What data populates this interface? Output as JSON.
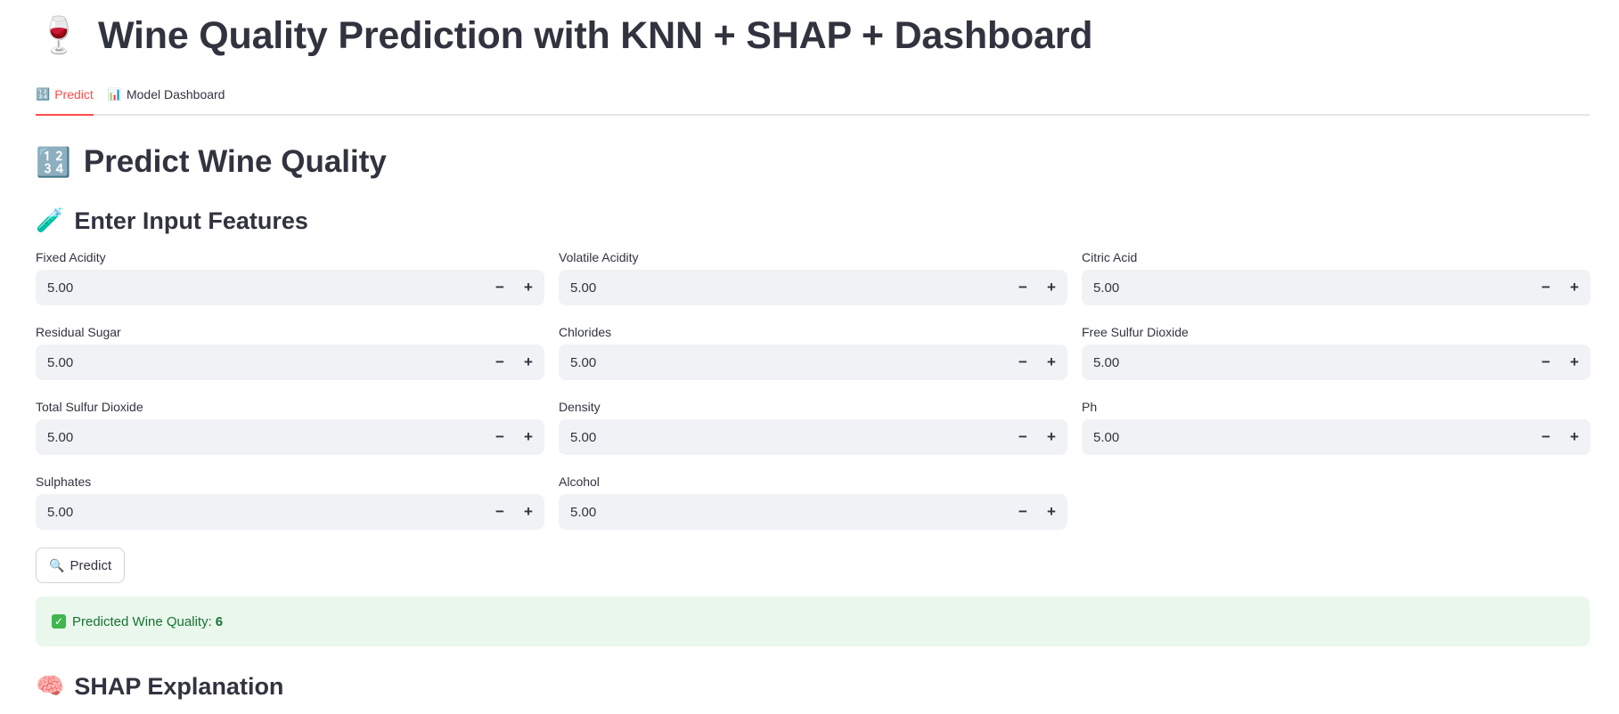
{
  "header": {
    "icon": "wine-glass-icon",
    "icon_glyph": "🍷",
    "title": "Wine Quality Prediction with KNN + SHAP + Dashboard"
  },
  "tabs": [
    {
      "icon": "input-numbers-icon",
      "icon_glyph": "🔢",
      "label": "Predict",
      "active": true
    },
    {
      "icon": "bar-chart-icon",
      "icon_glyph": "📊",
      "label": "Model Dashboard",
      "active": false
    }
  ],
  "predict": {
    "heading_icon": "input-numbers-icon",
    "heading_icon_glyph": "🔢",
    "heading": "Predict Wine Quality",
    "features_icon": "test-tube-icon",
    "features_icon_glyph": "🧪",
    "features_heading": "Enter Input Features",
    "fields": [
      {
        "label": "Fixed Acidity",
        "value": "5.00"
      },
      {
        "label": "Volatile Acidity",
        "value": "5.00"
      },
      {
        "label": "Citric Acid",
        "value": "5.00"
      },
      {
        "label": "Residual Sugar",
        "value": "5.00"
      },
      {
        "label": "Chlorides",
        "value": "5.00"
      },
      {
        "label": "Free Sulfur Dioxide",
        "value": "5.00"
      },
      {
        "label": "Total Sulfur Dioxide",
        "value": "5.00"
      },
      {
        "label": "Density",
        "value": "5.00"
      },
      {
        "label": "Ph",
        "value": "5.00"
      },
      {
        "label": "Sulphates",
        "value": "5.00"
      },
      {
        "label": "Alcohol",
        "value": "5.00"
      }
    ],
    "step_minus": "−",
    "step_plus": "+",
    "button_icon": "magnifier-icon",
    "button_icon_glyph": "🔍",
    "button_label": "Predict",
    "result_icon": "check-mark-icon",
    "result_icon_glyph": "✓",
    "result_label": "Predicted Wine Quality:",
    "result_value": "6",
    "shap_icon": "brain-icon",
    "shap_icon_glyph": "🧠",
    "shap_heading": "SHAP Explanation"
  },
  "colors": {
    "accent": "#ff4b4b",
    "input_bg": "#f0f2f6",
    "success_bg": "#eaf7ec",
    "success_text": "#177233"
  }
}
